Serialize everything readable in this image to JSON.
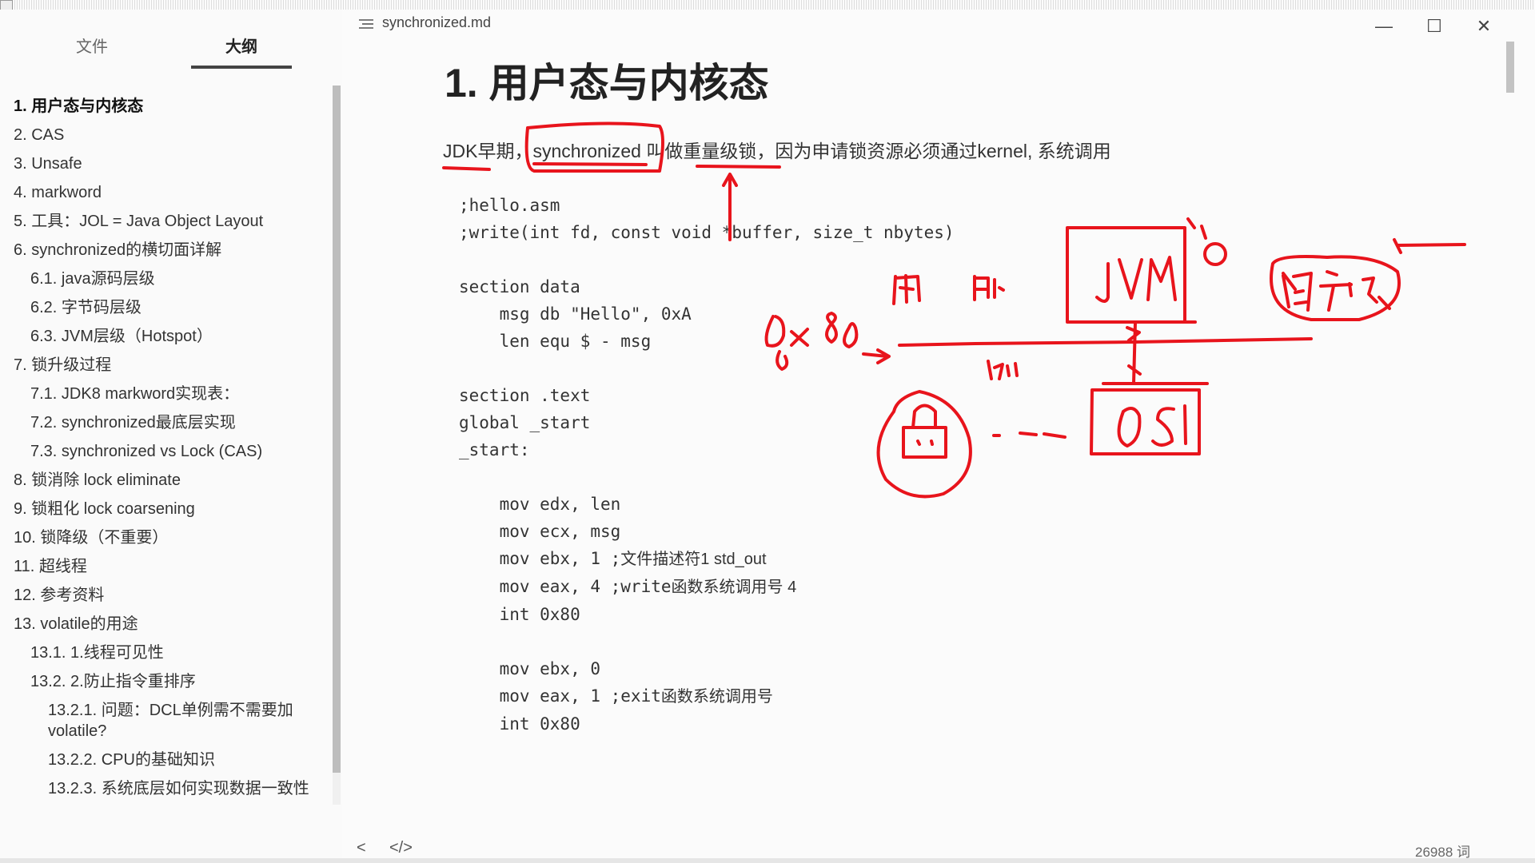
{
  "window": {
    "title": "synchronized.md",
    "min_symbol": "—",
    "max_symbol": "☐",
    "close_symbol": "✕"
  },
  "sidebar": {
    "tabs": [
      {
        "label": "文件"
      },
      {
        "label": "大纲"
      }
    ],
    "items": [
      {
        "label": "1. 用户态与内核态",
        "level": 1,
        "active": true
      },
      {
        "label": "2. CAS",
        "level": 1
      },
      {
        "label": "3. Unsafe",
        "level": 1
      },
      {
        "label": "4. markword",
        "level": 1
      },
      {
        "label": "5. 工具：JOL = Java Object Layout",
        "level": 1
      },
      {
        "label": "6. synchronized的横切面详解",
        "level": 1
      },
      {
        "label": "6.1. java源码层级",
        "level": 2
      },
      {
        "label": "6.2. 字节码层级",
        "level": 2
      },
      {
        "label": "6.3. JVM层级（Hotspot）",
        "level": 2
      },
      {
        "label": "7. 锁升级过程",
        "level": 1
      },
      {
        "label": "7.1. JDK8 markword实现表：",
        "level": 2
      },
      {
        "label": "7.2. synchronized最底层实现",
        "level": 2
      },
      {
        "label": "7.3. synchronized vs Lock (CAS)",
        "level": 2
      },
      {
        "label": "8. 锁消除 lock eliminate",
        "level": 1
      },
      {
        "label": "9. 锁粗化 lock coarsening",
        "level": 1
      },
      {
        "label": "10. 锁降级（不重要）",
        "level": 1
      },
      {
        "label": "11. 超线程",
        "level": 1
      },
      {
        "label": "12. 参考资料",
        "level": 1
      },
      {
        "label": "13. volatile的用途",
        "level": 1
      },
      {
        "label": "13.1. 1.线程可见性",
        "level": 2
      },
      {
        "label": "13.2. 2.防止指令重排序",
        "level": 2
      },
      {
        "label": "13.2.1. 问题：DCL单例需不需要加volatile?",
        "level": 3
      },
      {
        "label": "13.2.2. CPU的基础知识",
        "level": 3
      },
      {
        "label": "13.2.3. 系统底层如何实现数据一致性",
        "level": 3
      }
    ]
  },
  "document": {
    "heading": "1. 用户态与内核态",
    "paragraph": "JDK早期，synchronized 叫做重量级锁，因为申请锁资源必须通过kernel, 系统调用",
    "code_lines": [
      {
        "code": ";hello.asm"
      },
      {
        "code": ";write(int fd, const void *buffer, size_t nbytes)"
      },
      {
        "code": ""
      },
      {
        "code": "section data"
      },
      {
        "code": "    msg db \"Hello\", 0xA"
      },
      {
        "code": "    len equ $ - msg"
      },
      {
        "code": ""
      },
      {
        "code": "section .text"
      },
      {
        "code": "global _start"
      },
      {
        "code": "_start:"
      },
      {
        "code": ""
      },
      {
        "code": "    mov edx, len"
      },
      {
        "code": "    mov ecx, msg"
      },
      {
        "code": "    mov ebx, 1 ;",
        "comment": "文件描述符1 std_out"
      },
      {
        "code": "    mov eax, 4 ;write",
        "comment": "函数系统调用号 4"
      },
      {
        "code": "    int 0x80"
      },
      {
        "code": ""
      },
      {
        "code": "    mov ebx, 0"
      },
      {
        "code": "    mov eax, 1 ;exit",
        "comment": "函数系统调用号"
      },
      {
        "code": "    int 0x80"
      }
    ],
    "next_heading_peek": "2. CAS"
  },
  "footer": {
    "back_symbol": "<",
    "code_symbol": "</>",
    "word_count": "26988 词"
  },
  "colors": {
    "ink": "#e8141c",
    "text": "#333333",
    "background": "#fbfbfb"
  }
}
